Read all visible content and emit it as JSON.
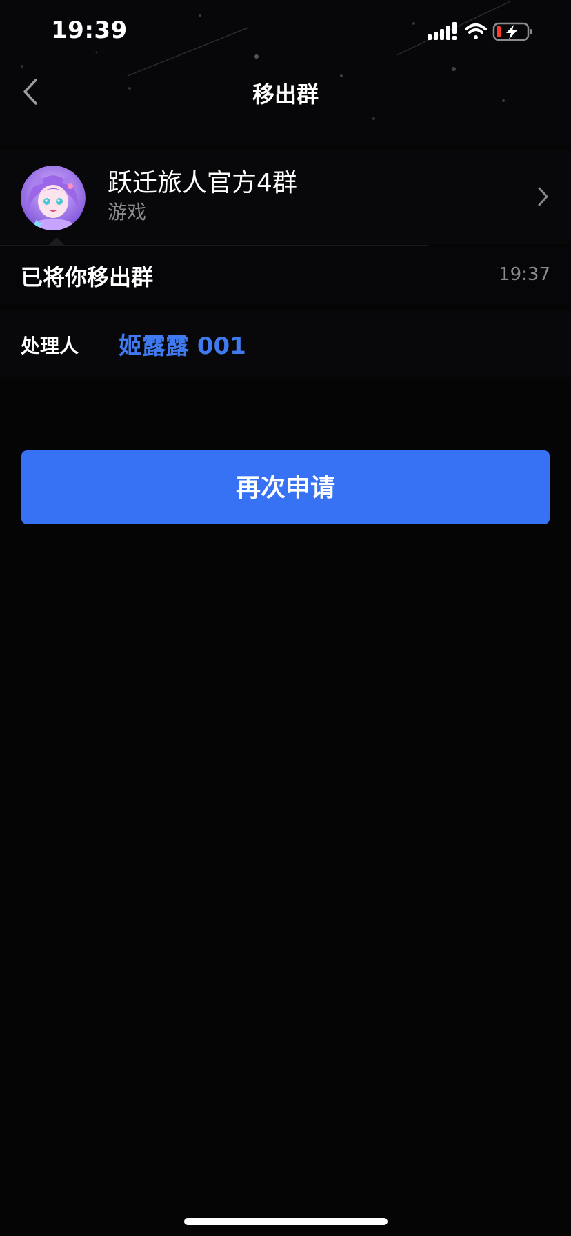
{
  "status_bar": {
    "time": "19:39",
    "icons": [
      "signal-icon",
      "wifi-icon",
      "battery-charging-icon"
    ]
  },
  "nav": {
    "title": "移出群",
    "back_icon": "chevron-left-icon"
  },
  "group": {
    "name": "跃迁旅人官方4群",
    "category": "游戏",
    "avatar_icon": "anime-girl-avatar"
  },
  "notice": {
    "text": "已将你移出群",
    "time": "19:37"
  },
  "handler": {
    "label": "处理人",
    "name": "姬露露 001"
  },
  "actions": {
    "reapply_label": "再次申请"
  },
  "colors": {
    "background": "#050506",
    "accent": "#3672f3",
    "link": "#3f7af0",
    "secondary_text": "#8a8a8f"
  }
}
